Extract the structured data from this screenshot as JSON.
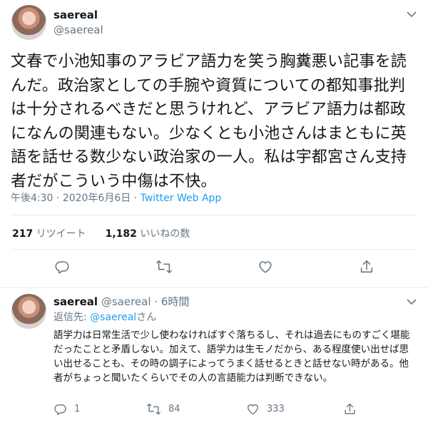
{
  "main_tweet": {
    "display_name": "saereal",
    "handle": "@saereal",
    "text": "文春で小池知事のアラビア語力を笑う胸糞悪い記事を読んだ。政治家としての手腕や資質についての都知事批判は十分されるべきだと思うけれど、アラビア語力は都政になんの関連もない。少なくとも小池さんはまともに英語を話せる数少ない政治家の一人。私は宇都宮さん支持者だがこういう中傷は不快。",
    "timestamp": "午後4:30 · 2020年6月6日",
    "separator": " · ",
    "app": "Twitter Web App",
    "retweets_count": "217",
    "retweets_label": "リツイート",
    "likes_count": "1,182",
    "likes_label": "いいねの数"
  },
  "reply_tweet": {
    "display_name": "saereal",
    "handle": "@saereal",
    "time": "· 6時間",
    "replying_prefix": "返信先: ",
    "replying_mention": "@saereal",
    "replying_suffix": "さん",
    "text": "語学力は日常生活で少し使わなければすぐ落ちるし、それは過去にものすごく堪能だったことと矛盾しない。加えて、語学力は生モノだから、ある程度使い出せば思い出せることも、その時の調子によってうまく話せるときと話せない時がある。他者がちょっと聞いたくらいでその人の言語能力は判断できない。",
    "reply_count": "1",
    "retweet_count": "84",
    "like_count": "333"
  },
  "icons": {
    "chevron": "chevron-down-icon",
    "reply": "reply-icon",
    "retweet": "retweet-icon",
    "like": "heart-icon",
    "share": "share-icon"
  },
  "colors": {
    "link": "#1da1f2",
    "secondary_text": "#657786",
    "primary_text": "#14171a",
    "divider": "#e6ecf0"
  }
}
